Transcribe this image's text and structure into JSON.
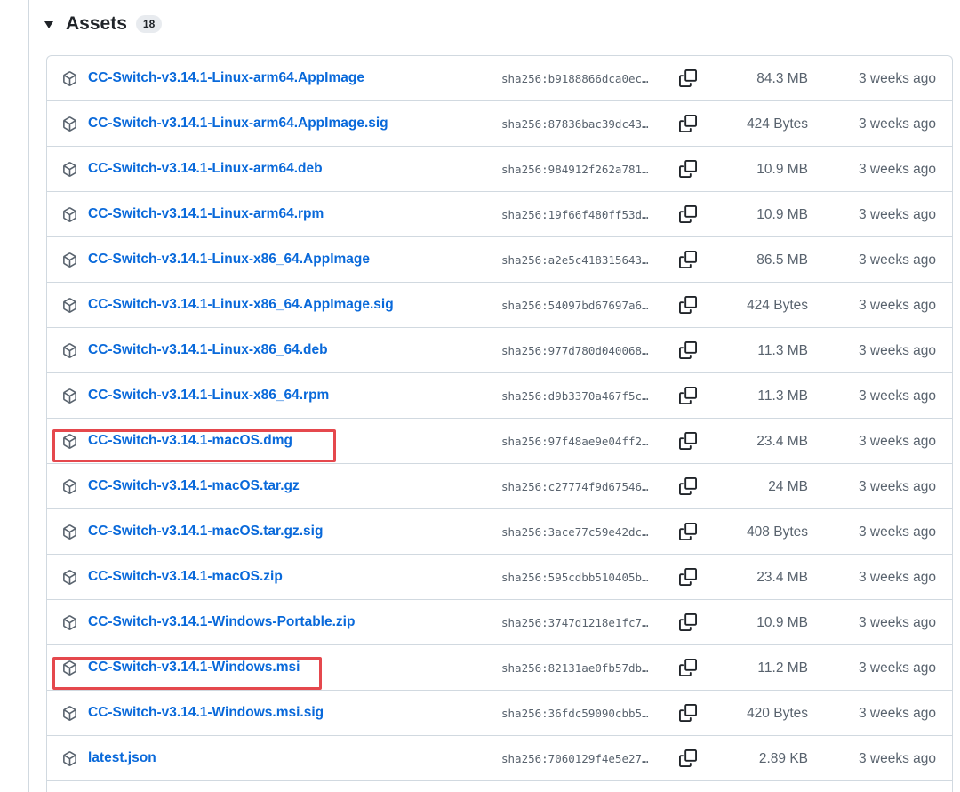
{
  "assets": {
    "title": "Assets",
    "count": "18",
    "rows": [
      {
        "name": "CC-Switch-v3.14.1-Linux-arm64.AppImage",
        "sha": "sha256:b9188866dca0ec…",
        "size": "84.3 MB",
        "date": "3 weeks ago",
        "highlighted": false
      },
      {
        "name": "CC-Switch-v3.14.1-Linux-arm64.AppImage.sig",
        "sha": "sha256:87836bac39dc43…",
        "size": "424 Bytes",
        "date": "3 weeks ago",
        "highlighted": false
      },
      {
        "name": "CC-Switch-v3.14.1-Linux-arm64.deb",
        "sha": "sha256:984912f262a781…",
        "size": "10.9 MB",
        "date": "3 weeks ago",
        "highlighted": false
      },
      {
        "name": "CC-Switch-v3.14.1-Linux-arm64.rpm",
        "sha": "sha256:19f66f480ff53d…",
        "size": "10.9 MB",
        "date": "3 weeks ago",
        "highlighted": false
      },
      {
        "name": "CC-Switch-v3.14.1-Linux-x86_64.AppImage",
        "sha": "sha256:a2e5c418315643…",
        "size": "86.5 MB",
        "date": "3 weeks ago",
        "highlighted": false
      },
      {
        "name": "CC-Switch-v3.14.1-Linux-x86_64.AppImage.sig",
        "sha": "sha256:54097bd67697a6…",
        "size": "424 Bytes",
        "date": "3 weeks ago",
        "highlighted": false
      },
      {
        "name": "CC-Switch-v3.14.1-Linux-x86_64.deb",
        "sha": "sha256:977d780d040068…",
        "size": "11.3 MB",
        "date": "3 weeks ago",
        "highlighted": false
      },
      {
        "name": "CC-Switch-v3.14.1-Linux-x86_64.rpm",
        "sha": "sha256:d9b3370a467f5c…",
        "size": "11.3 MB",
        "date": "3 weeks ago",
        "highlighted": false
      },
      {
        "name": "CC-Switch-v3.14.1-macOS.dmg",
        "sha": "sha256:97f48ae9e04ff2…",
        "size": "23.4 MB",
        "date": "3 weeks ago",
        "highlighted": true
      },
      {
        "name": "CC-Switch-v3.14.1-macOS.tar.gz",
        "sha": "sha256:c27774f9d67546…",
        "size": "24 MB",
        "date": "3 weeks ago",
        "highlighted": false
      },
      {
        "name": "CC-Switch-v3.14.1-macOS.tar.gz.sig",
        "sha": "sha256:3ace77c59e42dc…",
        "size": "408 Bytes",
        "date": "3 weeks ago",
        "highlighted": false
      },
      {
        "name": "CC-Switch-v3.14.1-macOS.zip",
        "sha": "sha256:595cdbb510405b…",
        "size": "23.4 MB",
        "date": "3 weeks ago",
        "highlighted": false
      },
      {
        "name": "CC-Switch-v3.14.1-Windows-Portable.zip",
        "sha": "sha256:3747d1218e1fc7…",
        "size": "10.9 MB",
        "date": "3 weeks ago",
        "highlighted": false
      },
      {
        "name": "CC-Switch-v3.14.1-Windows.msi",
        "sha": "sha256:82131ae0fb57db…",
        "size": "11.2 MB",
        "date": "3 weeks ago",
        "highlighted": true
      },
      {
        "name": "CC-Switch-v3.14.1-Windows.msi.sig",
        "sha": "sha256:36fdc59090cbb5…",
        "size": "420 Bytes",
        "date": "3 weeks ago",
        "highlighted": false
      },
      {
        "name": "latest.json",
        "sha": "sha256:7060129f4e5e27…",
        "size": "2.89 KB",
        "date": "3 weeks ago",
        "highlighted": false
      }
    ]
  },
  "icons": {
    "row_icon": "package-icon",
    "copy_icon": "copy-icon",
    "toggle_icon": "caret-down-icon"
  },
  "colors": {
    "link": "#0969da",
    "muted": "#59636e",
    "border": "#d1d9e0",
    "highlight": "#e5484d"
  }
}
